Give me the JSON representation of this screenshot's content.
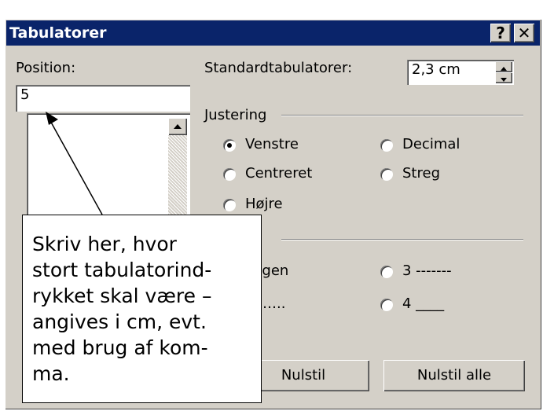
{
  "window": {
    "title": "Tabulatorer",
    "help_button": "?",
    "close_button": "✕"
  },
  "position": {
    "label": "Position:",
    "value": "5"
  },
  "default_tabs": {
    "label": "Standardtabulatorer:",
    "value": "2,3 cm"
  },
  "alignment": {
    "label": "Justering",
    "options": [
      "Venstre",
      "Decimal",
      "Centreret",
      "Streg",
      "Højre"
    ],
    "selected": "Venstre"
  },
  "leader": {
    "options": [
      "ngen",
      "3 -------",
      "…..",
      "4 ____"
    ]
  },
  "buttons": {
    "reset": "Nulstil",
    "reset_all": "Nulstil alle"
  },
  "callout": {
    "text": "Skriv her, hvor\nstort tabulatorind-\nrykket skal være –\nangives i cm, evt.\nmed brug af kom-\nma."
  },
  "colors": {
    "titlebar": "#0a246a",
    "dialog_face": "#d4d0c8"
  }
}
